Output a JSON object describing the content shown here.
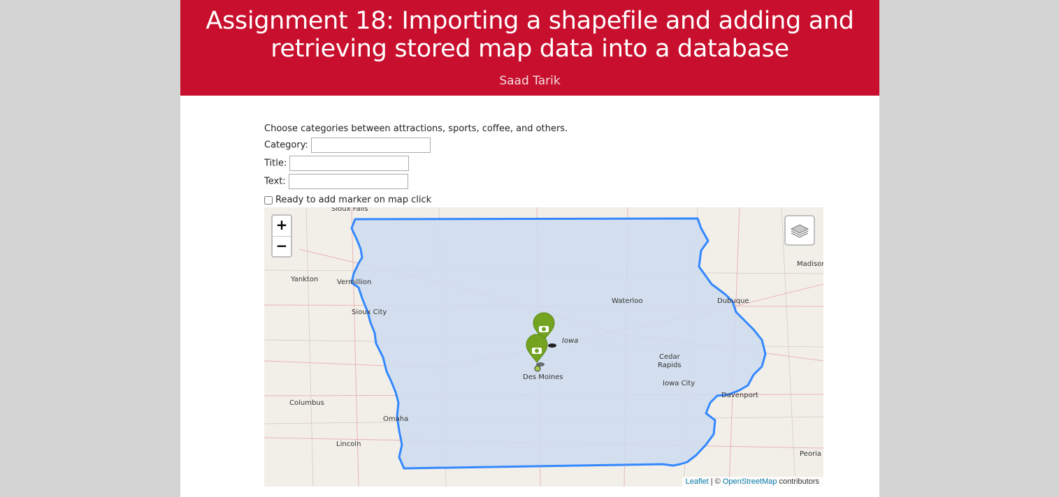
{
  "header": {
    "title": "Assignment 18: Importing a shapefile and adding and retrieving stored map data into a database",
    "author": "Saad Tarik",
    "background_color": "#c8102e"
  },
  "form": {
    "instructions": "Choose categories between attractions, sports, coffee, and others.",
    "category_label": "Category:",
    "category_value": "",
    "title_label": "Title:",
    "title_value": "",
    "text_label": "Text:",
    "text_value": "",
    "checkbox_label": "Ready to add marker on map click",
    "checkbox_checked": false
  },
  "map": {
    "zoom_in": "+",
    "zoom_out": "−",
    "layers_icon": "layers-icon",
    "state_fill_color": "#cfdcee",
    "state_border_color": "#3388ff",
    "marker_color": "#73a320",
    "marker_icon": "camera-icon",
    "state_label": "Iowa",
    "place_labels": [
      "Sioux Falls",
      "Yankton",
      "Vermillion",
      "Sioux City",
      "Madison",
      "Waterloo",
      "Dubuque",
      "Cedar Rapids",
      "Iowa City",
      "Des Moines",
      "Davenport",
      "Columbus",
      "Omaha",
      "Lincoln",
      "Peoria"
    ],
    "attribution": {
      "leaflet": "Leaflet",
      "separator": " | © ",
      "osm": "OpenStreetMap",
      "suffix": " contributors"
    }
  }
}
